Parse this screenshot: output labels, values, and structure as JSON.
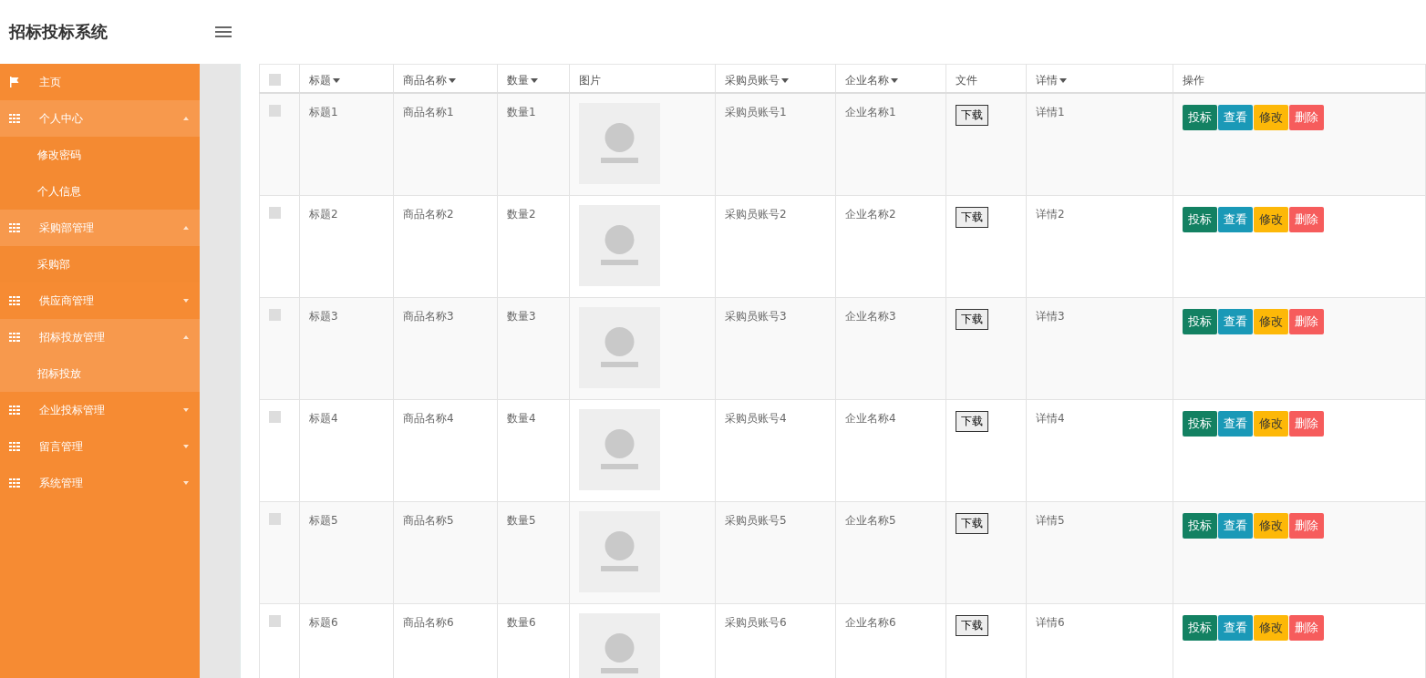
{
  "app": {
    "title": "招标投标系统"
  },
  "sidebar": {
    "items": [
      {
        "label": "主页",
        "kind": "link",
        "expanded": false
      },
      {
        "label": "个人中心",
        "kind": "group",
        "expanded": true,
        "children": [
          {
            "label": "修改密码",
            "selected": false
          },
          {
            "label": "个人信息",
            "selected": false
          }
        ]
      },
      {
        "label": "采购部管理",
        "kind": "group",
        "expanded": true,
        "children": [
          {
            "label": "采购部",
            "selected": false
          }
        ]
      },
      {
        "label": "供应商管理",
        "kind": "group",
        "expanded": false
      },
      {
        "label": "招标投放管理",
        "kind": "group",
        "expanded": true,
        "children": [
          {
            "label": "招标投放",
            "selected": true
          }
        ]
      },
      {
        "label": "企业投标管理",
        "kind": "group",
        "expanded": false
      },
      {
        "label": "留言管理",
        "kind": "group",
        "expanded": false
      },
      {
        "label": "系统管理",
        "kind": "group",
        "expanded": false
      }
    ]
  },
  "table": {
    "select_all_checked": false,
    "columns": [
      {
        "label": "标题",
        "sortable": true
      },
      {
        "label": "商品名称",
        "sortable": true
      },
      {
        "label": "数量",
        "sortable": true
      },
      {
        "label": "图片",
        "sortable": false
      },
      {
        "label": "采购员账号",
        "sortable": true
      },
      {
        "label": "企业名称",
        "sortable": true
      },
      {
        "label": "文件",
        "sortable": false
      },
      {
        "label": "详情",
        "sortable": true
      },
      {
        "label": "操作",
        "sortable": false
      }
    ],
    "rows": [
      {
        "checked": false,
        "title": "标题1",
        "product": "商品名称1",
        "quantity": "数量1",
        "buyer": "采购员账号1",
        "company": "企业名称1",
        "file_button": "下载",
        "detail": "详情1",
        "actions": [
          {
            "kind": "bid",
            "label": "投标"
          },
          {
            "kind": "view",
            "label": "查看"
          },
          {
            "kind": "edit",
            "label": "修改"
          },
          {
            "kind": "delete",
            "label": "删除"
          }
        ]
      },
      {
        "checked": false,
        "title": "标题2",
        "product": "商品名称2",
        "quantity": "数量2",
        "buyer": "采购员账号2",
        "company": "企业名称2",
        "file_button": "下载",
        "detail": "详情2",
        "actions": [
          {
            "kind": "bid",
            "label": "投标"
          },
          {
            "kind": "view",
            "label": "查看"
          },
          {
            "kind": "edit",
            "label": "修改"
          },
          {
            "kind": "delete",
            "label": "删除"
          }
        ]
      },
      {
        "checked": false,
        "title": "标题3",
        "product": "商品名称3",
        "quantity": "数量3",
        "buyer": "采购员账号3",
        "company": "企业名称3",
        "file_button": "下载",
        "detail": "详情3",
        "actions": [
          {
            "kind": "bid",
            "label": "投标"
          },
          {
            "kind": "view",
            "label": "查看"
          },
          {
            "kind": "edit",
            "label": "修改"
          },
          {
            "kind": "delete",
            "label": "删除"
          }
        ]
      },
      {
        "checked": false,
        "title": "标题4",
        "product": "商品名称4",
        "quantity": "数量4",
        "buyer": "采购员账号4",
        "company": "企业名称4",
        "file_button": "下载",
        "detail": "详情4",
        "actions": [
          {
            "kind": "bid",
            "label": "投标"
          },
          {
            "kind": "view",
            "label": "查看"
          },
          {
            "kind": "edit",
            "label": "修改"
          },
          {
            "kind": "delete",
            "label": "删除"
          }
        ]
      },
      {
        "checked": false,
        "title": "标题5",
        "product": "商品名称5",
        "quantity": "数量5",
        "buyer": "采购员账号5",
        "company": "企业名称5",
        "file_button": "下载",
        "detail": "详情5",
        "actions": [
          {
            "kind": "bid",
            "label": "投标"
          },
          {
            "kind": "view",
            "label": "查看"
          },
          {
            "kind": "edit",
            "label": "修改"
          },
          {
            "kind": "delete",
            "label": "删除"
          }
        ]
      },
      {
        "checked": false,
        "title": "标题6",
        "product": "商品名称6",
        "quantity": "数量6",
        "buyer": "采购员账号6",
        "company": "企业名称6",
        "file_button": "下载",
        "detail": "详情6",
        "actions": [
          {
            "kind": "bid",
            "label": "投标"
          },
          {
            "kind": "view",
            "label": "查看"
          },
          {
            "kind": "edit",
            "label": "修改"
          },
          {
            "kind": "delete",
            "label": "删除"
          }
        ]
      }
    ]
  }
}
